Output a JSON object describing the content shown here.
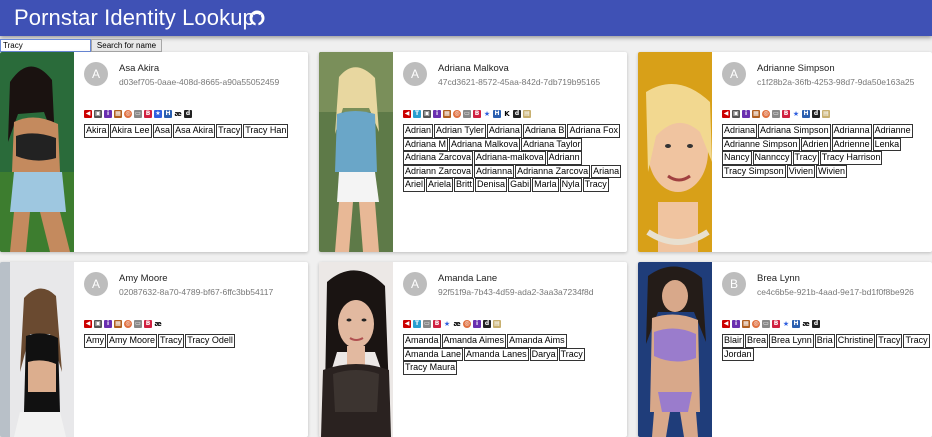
{
  "app": {
    "title": "Pornstar Identity Lookup",
    "github_icon": "github-icon"
  },
  "search": {
    "value": "Tracy",
    "button_label": "Search for name"
  },
  "cards": [
    {
      "name": "Asa Akira",
      "initial": "A",
      "uuid": "d03ef705-0aae-408d-8665-a90a55052459",
      "aliases": [
        "Akira",
        "Akira Lee",
        "Asa",
        "Asa Akira",
        "Tracy",
        "Tracy Han"
      ]
    },
    {
      "name": "Adriana Malkova",
      "initial": "A",
      "uuid": "47cd3621-8572-45aa-842d-7db719b95165",
      "aliases": [
        "Adrian",
        "Adrian Tyler",
        "Adriana",
        "Adriana B",
        "Adriana Fox",
        "Adriana M",
        "Adriana Malkova",
        "Adriana Taylor",
        "Adriana Zarcova",
        "Adriana-malkova",
        "Adriann",
        "Adriann Zarcova",
        "Adrianna",
        "Adrianna Zarcova",
        "Ariana",
        "Ariel",
        "Ariela",
        "Britt",
        "Denisa",
        "Gabi",
        "Marla",
        "Nyla",
        "Tracy"
      ]
    },
    {
      "name": "Adrianne Simpson",
      "initial": "A",
      "uuid": "c1f28b2a-36fb-4253-98d7-9da50e163a25",
      "aliases": [
        "Adriana",
        "Adriana Simpson",
        "Adrianna",
        "Adrianne",
        "Adrianne Simpson",
        "Adrien",
        "Adrienne",
        "Lenka",
        "Nancy",
        "Nanncсy",
        "Tracy",
        "Tracy Harrison",
        "Tracy Simpson",
        "Vivien",
        "Wivien"
      ]
    },
    {
      "name": "Amy Moore",
      "initial": "A",
      "uuid": "02087632-8a70-4789-bf67-6ffc3bb54117",
      "aliases": [
        "Amy",
        "Amy Moore",
        "Tracy",
        "Tracy Odell"
      ]
    },
    {
      "name": "Amanda Lane",
      "initial": "A",
      "uuid": "92f51f9a-7b43-4d59-ada2-3aa3a7234f8d",
      "aliases": [
        "Amanda",
        "Amanda Aimes",
        "Amanda Aims",
        "Amanda Lane",
        "Amanda Lanes",
        "Darya",
        "Tracy",
        "Tracy Maura"
      ]
    },
    {
      "name": "Brea Lynn",
      "initial": "B",
      "uuid": "ce4c6b5e-921b-4aad-9e17-bd1f0f8be926",
      "aliases": [
        "Blair",
        "Brea",
        "Brea Lynn",
        "Bria",
        "Christine",
        "Tracy",
        "Tracy",
        "Jordan"
      ]
    }
  ]
}
